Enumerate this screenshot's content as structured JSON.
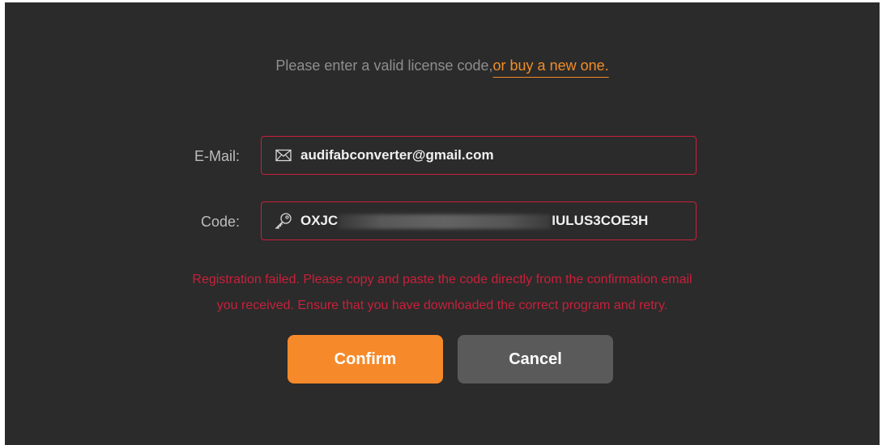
{
  "prompt": {
    "text": "Please enter a valid license code,",
    "link": "or buy a new one."
  },
  "email": {
    "label": "E-Mail:",
    "value": "audifabconverter@gmail.com",
    "icon": "envelope-icon"
  },
  "code": {
    "label": "Code:",
    "value_prefix": "OXJC",
    "value_suffix": "IULUS3COE3H",
    "icon": "key-icon"
  },
  "error": {
    "line1": "Registration failed. Please copy and paste the code directly from the confirmation email",
    "line2": "you received. Ensure that you have downloaded the correct program and retry."
  },
  "buttons": {
    "confirm": "Confirm",
    "cancel": "Cancel"
  },
  "colors": {
    "background": "#2b2b2b",
    "accent": "#f6892a",
    "error": "#c8203a",
    "cancel_button": "#5a5a5a"
  }
}
